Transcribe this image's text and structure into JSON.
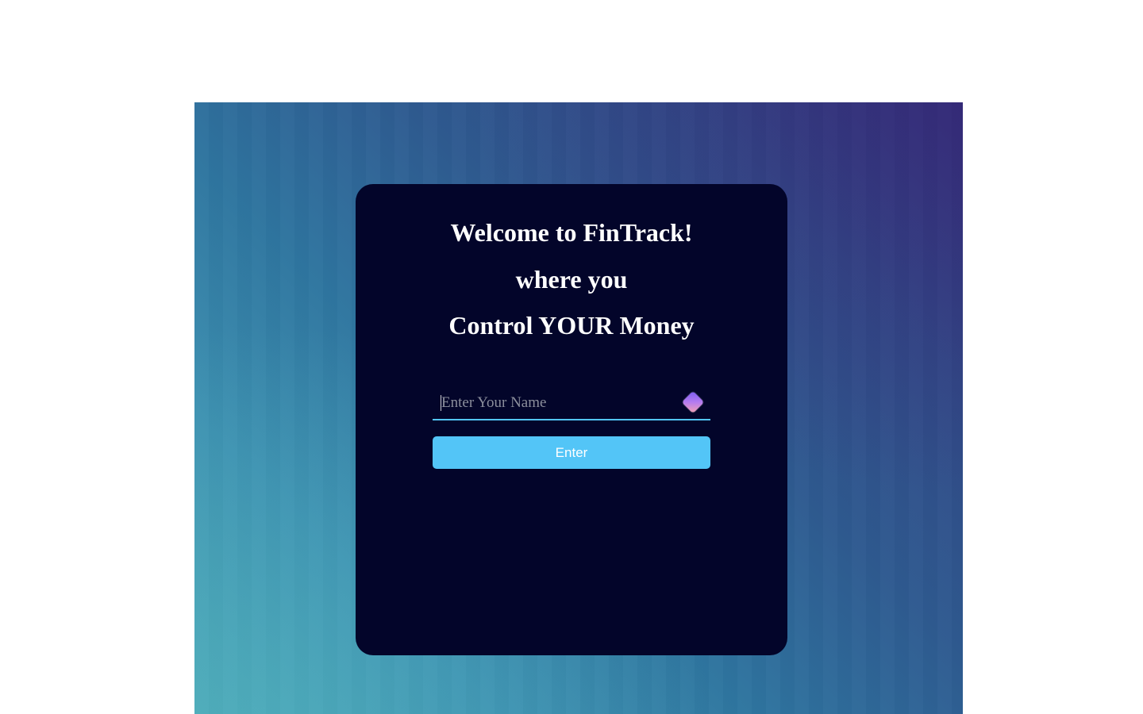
{
  "welcome": {
    "line1": "Welcome to FinTrack!",
    "line2": "where you",
    "line3": "Control YOUR Money"
  },
  "form": {
    "name_placeholder": "Enter Your Name",
    "name_value": "",
    "enter_label": "Enter",
    "input_icon": "diamond-icon"
  },
  "colors": {
    "card_bg": "#03052a",
    "accent": "#53c5f7",
    "text": "#ffffff"
  }
}
